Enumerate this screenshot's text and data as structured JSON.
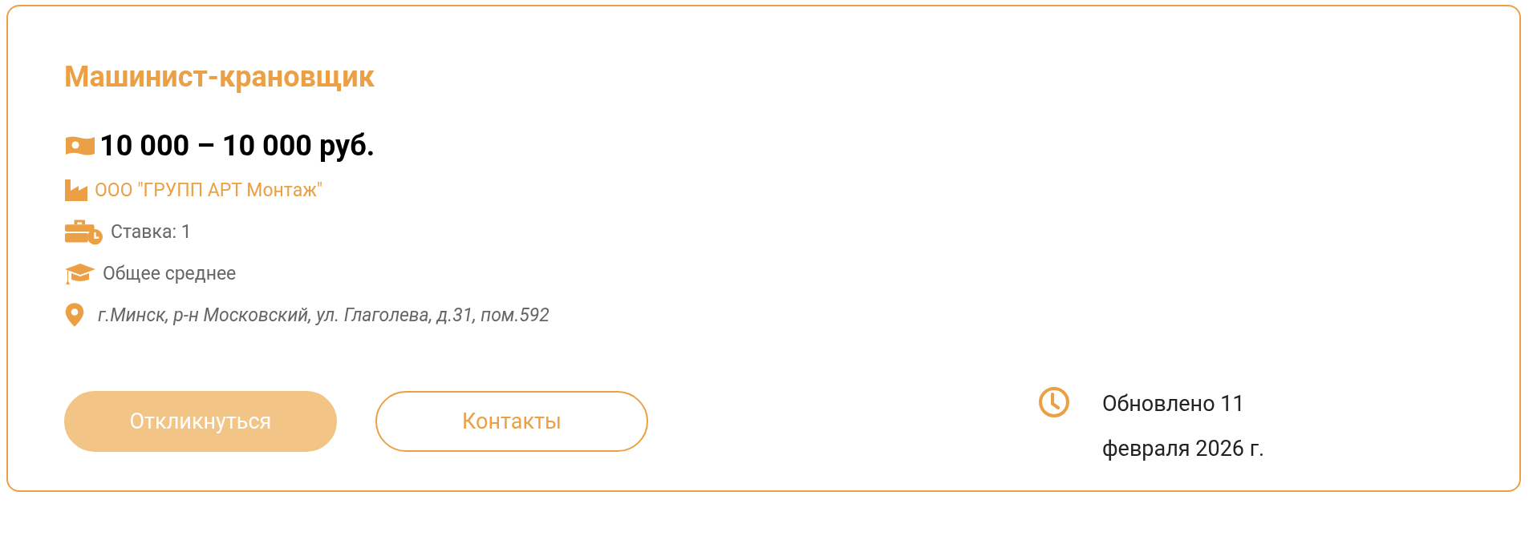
{
  "vacancy": {
    "title": "Машинист-крановщик",
    "salary": "10 000 – 10 000 руб.",
    "details": [
      {
        "kind": "company",
        "text": "ООО \"ГРУПП АРТ Монтаж\""
      },
      {
        "kind": "rate",
        "text": "Ставка: 1"
      },
      {
        "kind": "education",
        "text": "Общее среднее"
      },
      {
        "kind": "address",
        "text": "г.Минск, р-н Московский, ул. Глаголева, д.31, пом.592"
      }
    ],
    "buttons": [
      {
        "label": "Откликнуться",
        "kind": "filled"
      },
      {
        "label": "Контакты",
        "kind": "outline"
      }
    ],
    "updated": "Обновлено 11 февраля 2026 г."
  }
}
